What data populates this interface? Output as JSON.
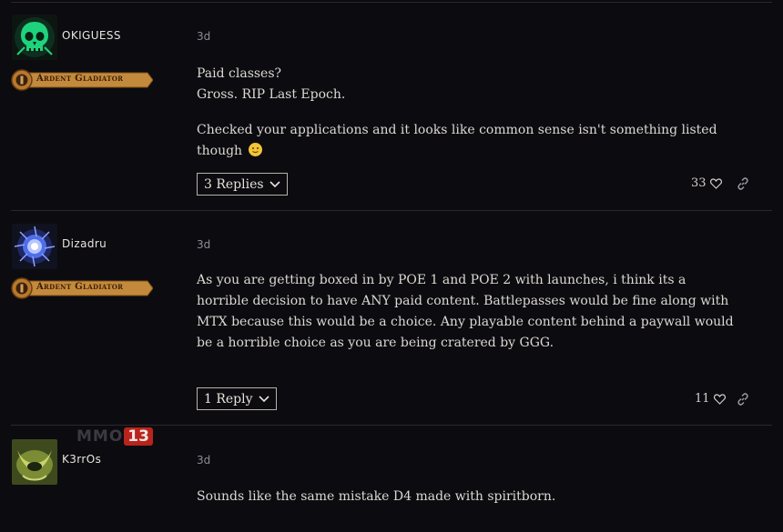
{
  "colors": {
    "background": "#0c0b10",
    "divider": "#2a282e",
    "badge_gold": "#c48a3c",
    "emoji_yellow": "#f2c437"
  },
  "posts": [
    {
      "username": "OKIGUESS",
      "avatar_icon": "green-skull-avatar",
      "badge": "Ardent Gladiator",
      "time": "3d",
      "paragraphs": [
        "Paid classes?",
        "Gross. RIP Last Epoch.",
        "Checked your applications and it looks like common sense isn't something listed though"
      ],
      "replies_label": "3 Replies",
      "likes": "33"
    },
    {
      "username": "Dizadru",
      "avatar_icon": "blue-orb-avatar",
      "badge": "Ardent Gladiator",
      "time": "3d",
      "paragraphs": [
        "As you are getting boxed in by POE 1 and POE 2 with launches, i think its a horrible decision to have ANY paid content. Battlepasses would be fine along with MTX because this would be a choice. Any playable content behind a paywall would be a horrible choice as you are being cratered by GGG."
      ],
      "replies_label": "1 Reply",
      "likes": "11"
    },
    {
      "username": "K3rrOs",
      "avatar_icon": "green-horns-avatar",
      "time": "3d",
      "paragraphs": [
        "Sounds like the same mistake D4 made with spiritborn."
      ]
    }
  ],
  "watermark": {
    "text": "MMO",
    "number": "13"
  }
}
